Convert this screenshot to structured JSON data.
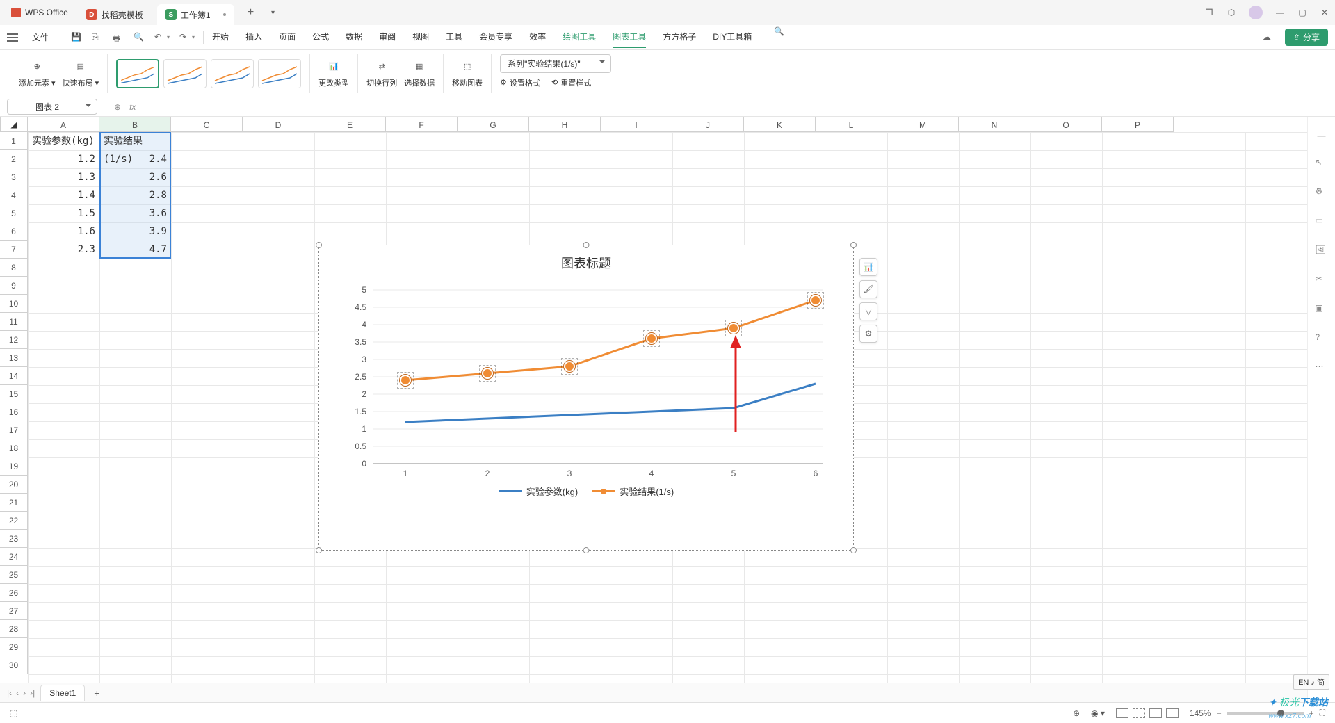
{
  "titlebar": {
    "app_name": "WPS Office",
    "tabs": [
      {
        "label": "找稻壳模板",
        "icon": "red"
      },
      {
        "label": "工作簿1",
        "icon": "green"
      }
    ]
  },
  "menubar": {
    "file": "文件",
    "tabs": [
      "开始",
      "插入",
      "页面",
      "公式",
      "数据",
      "审阅",
      "视图",
      "工具",
      "会员专享",
      "效率",
      "绘图工具",
      "图表工具",
      "方方格子",
      "DIY工具箱"
    ],
    "active": "图表工具",
    "share": "分享"
  },
  "ribbon": {
    "add_element": "添加元素",
    "quick_layout": "快速布局",
    "change_type": "更改类型",
    "swap_rc": "切换行列",
    "select_data": "选择数据",
    "move_chart": "移动图表",
    "series_selector": "系列\"实验结果(1/s)\"",
    "set_format": "设置格式",
    "reset_style": "重置样式"
  },
  "formula_bar": {
    "name_box": "图表 2",
    "fx": "fx"
  },
  "columns": [
    "A",
    "B",
    "C",
    "D",
    "E",
    "F",
    "G",
    "H",
    "I",
    "J",
    "K",
    "L",
    "M",
    "N",
    "O",
    "P"
  ],
  "rows": 30,
  "data": {
    "A1": "实验参数(kg)",
    "B1": "实验结果(1/s)",
    "A": [
      "1.2",
      "1.3",
      "1.4",
      "1.5",
      "1.6",
      "2.3"
    ],
    "B": [
      "2.4",
      "2.6",
      "2.8",
      "3.6",
      "3.9",
      "4.7"
    ]
  },
  "chart": {
    "title": "图表标题",
    "series1_name": "实验参数(kg)",
    "series2_name": "实验结果(1/s)"
  },
  "sheet_tabs": {
    "sheet1": "Sheet1"
  },
  "statusbar": {
    "zoom": "145%",
    "lang": "EN ♪ 简"
  },
  "chart_data": {
    "type": "line",
    "title": "图表标题",
    "categories": [
      1,
      2,
      3,
      4,
      5,
      6
    ],
    "series": [
      {
        "name": "实验参数(kg)",
        "values": [
          1.2,
          1.3,
          1.4,
          1.5,
          1.6,
          2.3
        ],
        "color": "#3b7fc4",
        "marker": false
      },
      {
        "name": "实验结果(1/s)",
        "values": [
          2.4,
          2.6,
          2.8,
          3.6,
          3.9,
          4.7
        ],
        "color": "#f08c34",
        "marker": true
      }
    ],
    "ylim": [
      0,
      5
    ],
    "ytick": 0.5,
    "xlabel": "",
    "ylabel": ""
  },
  "watermark": {
    "a": "极光",
    "b": "下载站",
    "url": "www.xz7.com"
  }
}
